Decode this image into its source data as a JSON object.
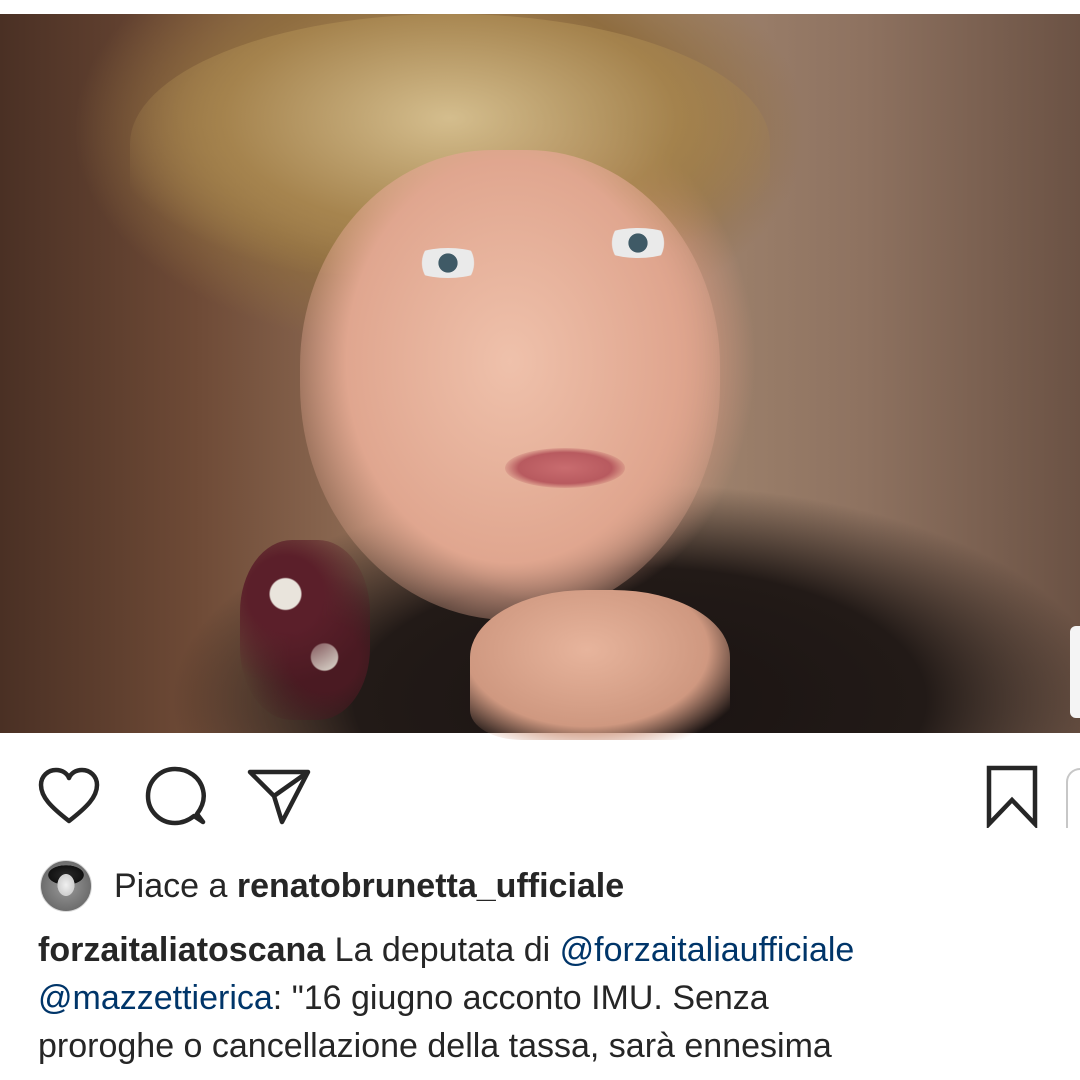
{
  "post": {
    "image_description": "",
    "actions": {
      "like_icon": "heart-icon",
      "comment_icon": "comment-icon",
      "share_icon": "send-icon",
      "save_icon": "bookmark-icon"
    },
    "likes": {
      "prefix": "Piace a ",
      "username": "renatobrunetta_ufficiale"
    },
    "caption": {
      "author": "forzaitaliatoscana",
      "line1_text": " La deputata di ",
      "mention1": "@forzaitaliaufficiale",
      "mention2": "@mazzettierica",
      "line2_text": ": \"16 giugno acconto IMU. Senza",
      "line3_text": "proroghe o cancellazione della tassa, sarà ennesima"
    }
  },
  "colors": {
    "text": "#262626",
    "mention": "#003569",
    "background": "#ffffff"
  }
}
